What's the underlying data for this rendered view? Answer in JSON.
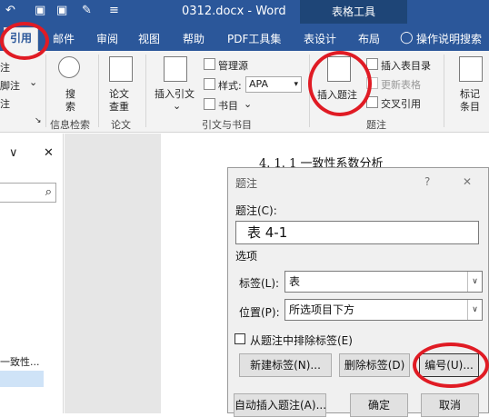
{
  "titlebar": {
    "doc_title": "0312.docx  -  Word",
    "table_tools": "表格工具",
    "quick_access": [
      "↶",
      "▣",
      "✎",
      "≡"
    ]
  },
  "tabs": {
    "references": "引用",
    "mailings": "邮件",
    "review": "审阅",
    "view": "视图",
    "help": "帮助",
    "pdf_tools": "PDF工具集",
    "table_design": "表设计",
    "layout": "布局",
    "tell_me": "操作说明搜索"
  },
  "ribbon": {
    "left_cut_1": "注",
    "left_cut_2": "脚注",
    "left_cut_3": "注",
    "search_label_1": "搜",
    "search_label_2": "索",
    "info_search_group": "信息检索",
    "paper_check_1": "论文",
    "paper_check_2": "查重",
    "paper_group": "论文",
    "insert_citation": "插入引文",
    "manage_sources": "管理源",
    "style_label": "样式:",
    "style_value": "APA",
    "bibliography": "书目",
    "citations_group": "引文与书目",
    "insert_caption": "插入题注",
    "insert_table_of_figures": "插入表目录",
    "update_table": "更新表格",
    "cross_reference": "交叉引用",
    "captions_group": "题注",
    "mark_entry_1": "标记",
    "mark_entry_2": "条目"
  },
  "nav_pane": {
    "close": "✕",
    "chevron": "∨",
    "search_icon": "⌕",
    "item": "一致性..."
  },
  "document": {
    "heading": "4. 1. 1 一致性系数分析"
  },
  "dialog": {
    "title": "题注",
    "help": "?",
    "close": "✕",
    "caption_label": "题注(C):",
    "caption_value": "表  4-1",
    "options_label": "选项",
    "label_label": "标签(L):",
    "label_value": "表",
    "position_label": "位置(P):",
    "position_value": "所选项目下方",
    "exclude_label": "从题注中排除标签(E)",
    "new_label_button": "新建标签(N)...",
    "delete_label_button": "删除标签(D)",
    "numbering_button": "编号(U)...",
    "autocaption_button": "自动插入题注(A)...",
    "ok_button": "确定",
    "cancel_button": "取消"
  },
  "colors": {
    "brand": "#2b579a",
    "highlight_circle": "#e01b24"
  }
}
